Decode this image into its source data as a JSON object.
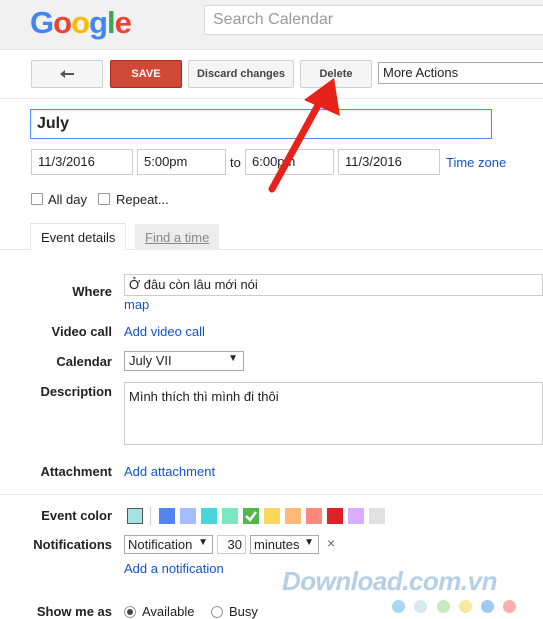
{
  "logo": {
    "letters": [
      "G",
      "o",
      "o",
      "g",
      "l",
      "e"
    ],
    "colors": [
      "#4285f4",
      "#ea4335",
      "#fbbc05",
      "#4285f4",
      "#34a853",
      "#ea4335"
    ]
  },
  "search": {
    "placeholder": "Search Calendar"
  },
  "toolbar": {
    "back_icon": "back-arrow-icon",
    "save_label": "SAVE",
    "discard_label": "Discard changes",
    "delete_label": "Delete",
    "more_actions_label": "More Actions"
  },
  "event": {
    "title": "July",
    "start_date": "11/3/2016",
    "start_time": "5:00pm",
    "to_label": "to",
    "end_time": "6:00pm",
    "end_date": "11/3/2016",
    "time_zone_label": "Time zone",
    "all_day_label": "All day",
    "repeat_label": "Repeat..."
  },
  "tabs": {
    "event_details": "Event details",
    "find_time": "Find a time"
  },
  "details": {
    "where_label": "Where",
    "where_value": "Ở đâu còn lâu mới nói",
    "map_link": "map",
    "video_label": "Video call",
    "video_link": "Add video call",
    "calendar_label": "Calendar",
    "calendar_value": "July VII",
    "description_label": "Description",
    "description_value": "Mình thích thì mình đi thôi",
    "attachment_label": "Attachment",
    "attachment_link": "Add attachment",
    "event_color_label": "Event color",
    "event_colors": [
      "#a4e2e4",
      "#5484ed",
      "#a4bdfc",
      "#46d6db",
      "#7ae7bf",
      "#51b749",
      "#fbd75b",
      "#ffb878",
      "#ff887c",
      "#dc2127",
      "#dbadff",
      "#e1e1e1"
    ],
    "notifications_label": "Notifications",
    "notification_type": "Notification",
    "notification_amount": "30",
    "notification_unit": "minutes",
    "remove_icon": "×",
    "add_notification_link": "Add a notification",
    "show_me_as_label": "Show me as",
    "available_label": "Available",
    "busy_label": "Busy"
  },
  "watermark": {
    "text": "Download.com.vn",
    "dot_colors": [
      "#a8d8f0",
      "#d8e8f0",
      "#c8e8c0",
      "#f8e8a0",
      "#a0c8f0",
      "#f8b0b0"
    ]
  },
  "annotation": {
    "arrow_color": "#e8211b"
  }
}
